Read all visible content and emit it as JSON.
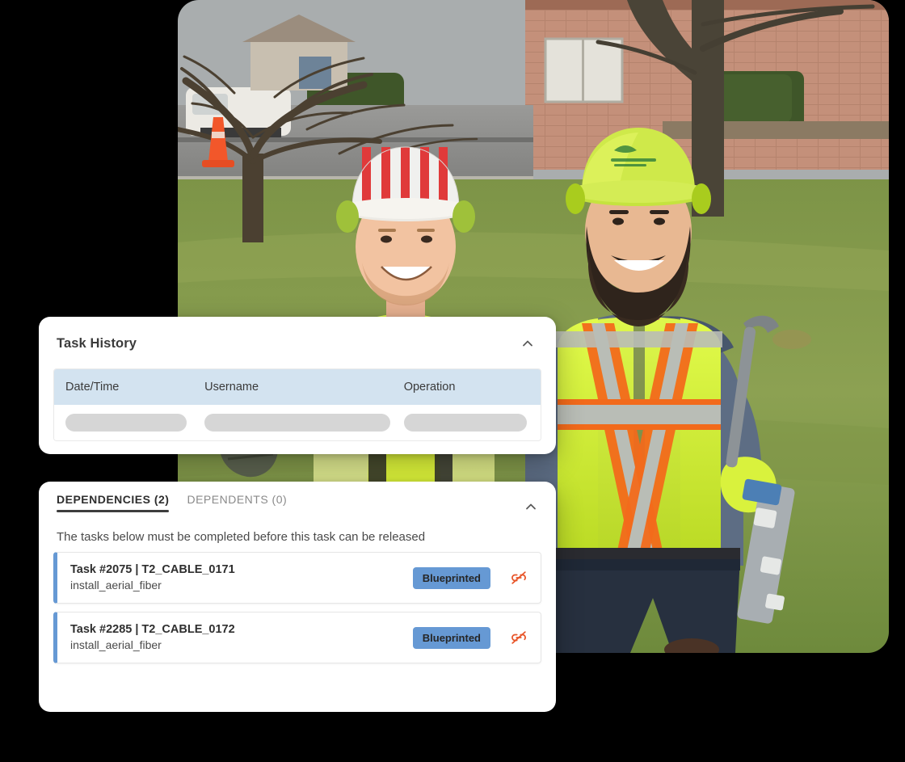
{
  "photo": {
    "alt_description": "Two utility field technicians in high-visibility yellow-green safety vests and hard hats standing on a suburban lawn in front of a brick house, one holding a cable placement tool",
    "colors": {
      "sky": "#b9bdbe",
      "brick": "#c79279",
      "grass": "#6f8a3f",
      "grass_light": "#93a656",
      "hivis": "#d6f531",
      "hivis_dark": "#a9cc1e",
      "orange_stripe": "#f26a1b",
      "silver_stripe": "#b9bdb6",
      "road": "#8d8d8d",
      "tree": "#4e4230",
      "denim": "#27303f",
      "cone": "#f2572a",
      "shrub": "#3c5227",
      "hoodie": "#5a6b84",
      "tool_metal": "#a8aeb2"
    }
  },
  "task_history_card": {
    "title": "Task History",
    "collapse_icon": "chevron-up-icon",
    "table": {
      "columns": [
        "Date/Time",
        "Username",
        "Operation"
      ],
      "rows": [
        {
          "date_time": "",
          "username": "",
          "operation": ""
        }
      ]
    }
  },
  "dependencies_card": {
    "collapse_icon": "chevron-up-icon",
    "tabs": [
      {
        "label": "DEPENDENCIES (2)",
        "active": true
      },
      {
        "label": "DEPENDENTS (0)",
        "active": false
      }
    ],
    "description": "The tasks below must be completed before this task can be released",
    "items": [
      {
        "title": "Task #2075 | T2_CABLE_0171",
        "subtitle": "install_aerial_fiber",
        "status": "Blueprinted",
        "status_color": "#6699d4",
        "accent_color": "#6699d4",
        "action_icon": "unlink-icon",
        "action_icon_color": "#e8562a"
      },
      {
        "title": "Task #2285 | T2_CABLE_0172",
        "subtitle": "install_aerial_fiber",
        "status": "Blueprinted",
        "status_color": "#6699d4",
        "accent_color": "#6699d4",
        "action_icon": "unlink-icon",
        "action_icon_color": "#e8562a"
      }
    ]
  }
}
